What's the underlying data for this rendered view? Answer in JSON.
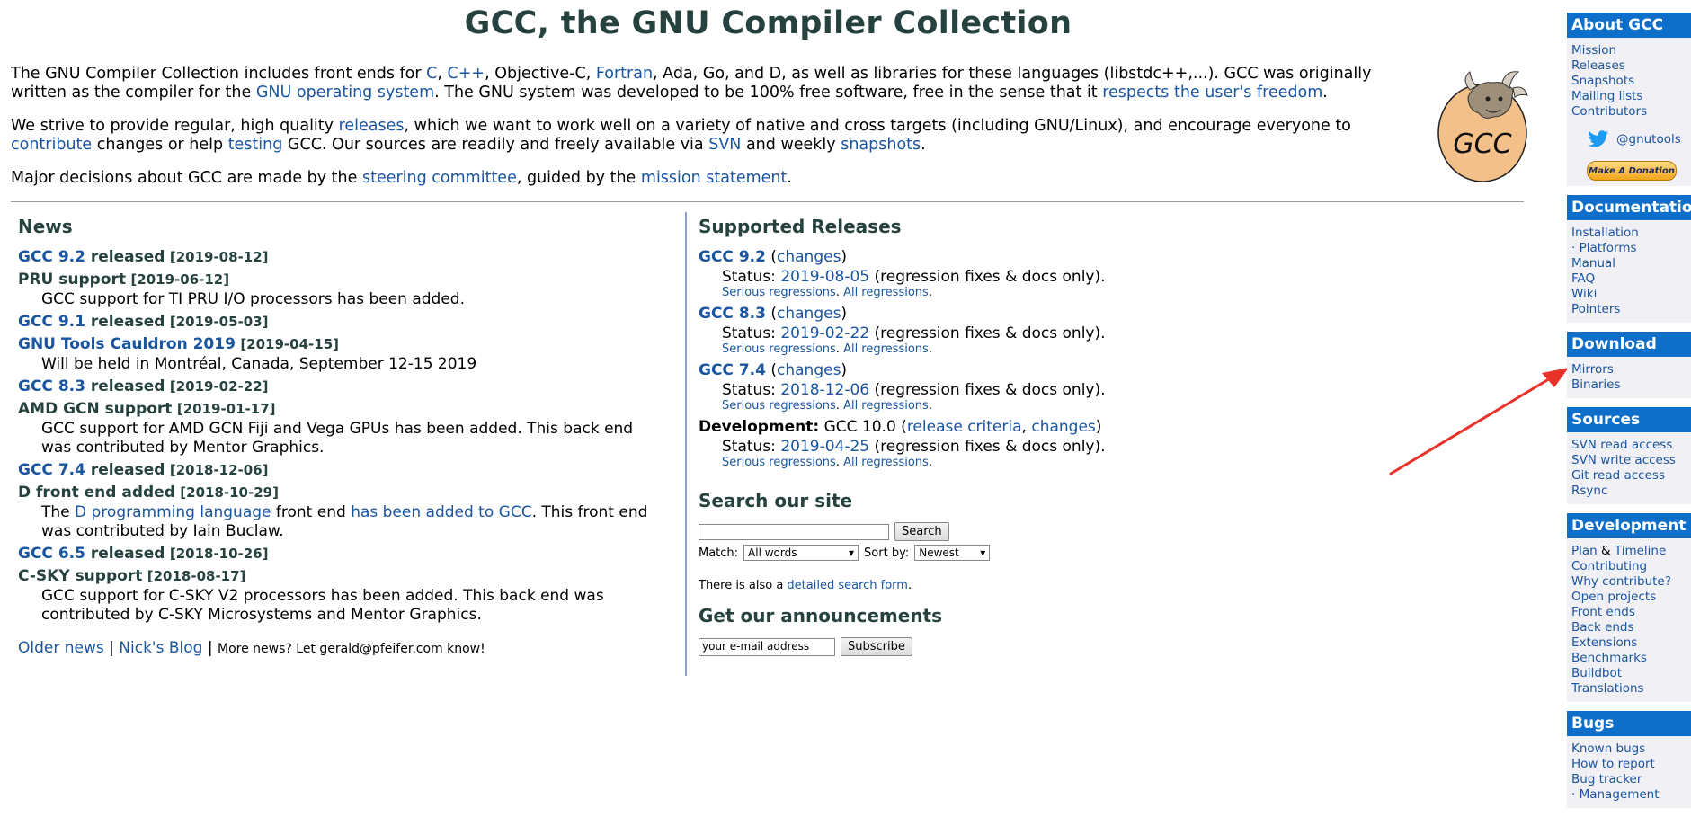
{
  "page": {
    "title": "GCC, the GNU Compiler Collection",
    "intro1": {
      "t1": "The GNU Compiler Collection includes front ends for ",
      "l1": "C",
      "t2": ", ",
      "l2": "C++",
      "t3": ", Objective-C, ",
      "l3": "Fortran",
      "t4": ", Ada, Go, and D, as well as libraries for these languages (libstdc++,...). GCC was originally written as the compiler for the ",
      "l4": "GNU operating system",
      "t5": ". The GNU system was developed to be 100% free software, free in the sense that it ",
      "l5": "respects the user's freedom",
      "t6": "."
    },
    "intro2": {
      "t1": "We strive to provide regular, high quality ",
      "l1": "releases",
      "t2": ", which we want to work well on a variety of native and cross targets (including GNU/Linux), and encourage everyone to ",
      "l2": "contribute",
      "t3": " changes or help ",
      "l3": "testing",
      "t4": " GCC. Our sources are readily and freely available via ",
      "l4": "SVN",
      "t5": " and weekly ",
      "l5": "snapshots",
      "t6": "."
    },
    "intro3": {
      "t1": "Major decisions about GCC are made by the ",
      "l1": "steering committee",
      "t2": ", guided by the ",
      "l2": "mission statement",
      "t3": "."
    },
    "logo_text": "GCC"
  },
  "news": {
    "heading": "News",
    "items": [
      {
        "link": "GCC 9.2",
        "rest": " released",
        "date": "[2019-08-12]"
      },
      {
        "title": "PRU support",
        "date": "[2019-06-12]",
        "desc": "GCC support for TI PRU I/O processors has been added."
      },
      {
        "link": "GCC 9.1",
        "rest": " released",
        "date": "[2019-05-03]"
      },
      {
        "link": "GNU Tools Cauldron 2019",
        "date": "[2019-04-15]",
        "desc": "Will be held in Montréal, Canada, September 12-15 2019"
      },
      {
        "link": "GCC 8.3",
        "rest": " released",
        "date": "[2019-02-22]"
      },
      {
        "title": "AMD GCN support",
        "date": "[2019-01-17]",
        "desc": "GCC support for AMD GCN Fiji and Vega GPUs has been added. This back end was contributed by Mentor Graphics."
      },
      {
        "link": "GCC 7.4",
        "rest": " released",
        "date": "[2018-12-06]"
      },
      {
        "title": "D front end added",
        "date": "[2018-10-29]",
        "desc_t1": "The ",
        "desc_l1": "D programming language",
        "desc_t2": " front end ",
        "desc_l2": "has been added to GCC",
        "desc_t3": ". This front end was contributed by Iain Buclaw."
      },
      {
        "link": "GCC 6.5",
        "rest": " released",
        "date": "[2018-10-26]"
      },
      {
        "title": "C-SKY support",
        "date": "[2018-08-17]",
        "desc": "GCC support for C-SKY V2 processors has been added. This back end was contributed by C-SKY Microsystems and Mentor Graphics."
      }
    ],
    "footer": {
      "older": "Older news",
      "sep1": " | ",
      "blog": "Nick's Blog",
      "sep2": " | ",
      "more": "More news? Let gerald@pfeifer.com know!"
    }
  },
  "releases": {
    "heading": "Supported Releases",
    "items": [
      {
        "name": "GCC 9.2",
        "changes": "changes",
        "status_label": "Status: ",
        "status_date": "2019-08-05",
        "status_note": " (regression fixes & docs only).",
        "serious": "Serious regressions",
        "all": "All regressions"
      },
      {
        "name": "GCC 8.3",
        "changes": "changes",
        "status_label": "Status: ",
        "status_date": "2019-02-22",
        "status_note": " (regression fixes & docs only).",
        "serious": "Serious regressions",
        "all": "All regressions"
      },
      {
        "name": "GCC 7.4",
        "changes": "changes",
        "status_label": "Status: ",
        "status_date": "2018-12-06",
        "status_note": " (regression fixes & docs only).",
        "serious": "Serious regressions",
        "all": "All regressions"
      }
    ],
    "dev": {
      "label": "Development:",
      "version": " GCC 10.0 (",
      "criteria": "release criteria",
      "comma": ", ",
      "changes": "changes",
      "close": ")",
      "status_label": "Status: ",
      "status_date": "2019-04-25",
      "status_note": " (regression fixes & docs only).",
      "serious": "Serious regressions",
      "all": "All regressions"
    }
  },
  "search": {
    "heading": "Search our site",
    "button": "Search",
    "match_label": "Match:",
    "match_value": "All words",
    "sort_label": "Sort by:",
    "sort_value": "Newest",
    "also_t1": "There is also a ",
    "also_link": "detailed search form",
    "also_t2": "."
  },
  "announce": {
    "heading": "Get our announcements",
    "email_value": "your e-mail address",
    "button": "Subscribe"
  },
  "sidebar": {
    "about": {
      "heading": "About GCC",
      "items": [
        "Mission",
        "Releases",
        "Snapshots",
        "Mailing lists",
        "Contributors"
      ],
      "twitter": "@gnutools",
      "donate": "Make A Donation"
    },
    "documentation": {
      "heading": "Documentation",
      "items": [
        "Installation",
        "· Platforms",
        "Manual",
        "FAQ",
        "Wiki",
        "Pointers"
      ]
    },
    "download": {
      "heading": "Download",
      "items": [
        "Mirrors",
        "Binaries"
      ]
    },
    "sources": {
      "heading": "Sources",
      "items": [
        "SVN read access",
        "SVN write access",
        "Git read access",
        "Rsync"
      ]
    },
    "development": {
      "heading": "Development",
      "plan": "Plan",
      "amp": " & ",
      "timeline": "Timeline",
      "items": [
        "Contributing",
        "Why contribute?",
        "Open projects",
        "Front ends",
        "Back ends",
        "Extensions",
        "Benchmarks",
        "Buildbot",
        "Translations"
      ]
    },
    "bugs": {
      "heading": "Bugs",
      "items": [
        "Known bugs",
        "How to report",
        "Bug tracker",
        "· Management"
      ]
    }
  },
  "colors": {
    "link": "#1a55a0",
    "heading": "#26423f",
    "sidebar_header": "#0d6fc9",
    "arrow": "#e8322a"
  }
}
